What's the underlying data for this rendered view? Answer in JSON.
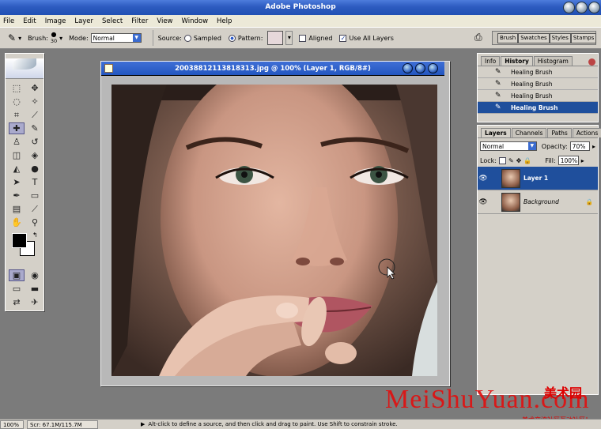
{
  "app": {
    "title": "Adobe Photoshop"
  },
  "menu": [
    "File",
    "Edit",
    "Image",
    "Layer",
    "Select",
    "Filter",
    "View",
    "Window",
    "Help"
  ],
  "options": {
    "brush_label": "Brush:",
    "brush_size": "30",
    "mode_label": "Mode:",
    "mode_value": "Normal",
    "source_label": "Source:",
    "sampled": "Sampled",
    "pattern": "Pattern:",
    "aligned": "Aligned",
    "use_all_layers": "Use All Layers"
  },
  "palette_well": [
    "Brush",
    "Swatches",
    "Styles",
    "Stamps"
  ],
  "document": {
    "title": "20038812113818313.jpg @ 100% (Layer 1, RGB/8#)"
  },
  "history": {
    "tabs": [
      "Info",
      "History",
      "Histogram"
    ],
    "items": [
      "Healing Brush",
      "Healing Brush",
      "Healing Brush",
      "Healing Brush"
    ]
  },
  "layers": {
    "tabs": [
      "Layers",
      "Channels",
      "Paths",
      "Actions"
    ],
    "blend": "Normal",
    "opacity_label": "Opacity:",
    "opacity": "70%",
    "lock_label": "Lock:",
    "fill_label": "Fill:",
    "fill": "100%",
    "rows": [
      "Layer 1",
      "Background"
    ]
  },
  "status": {
    "zoom": "100%",
    "scratch": "Scr: 67.1M/115.7M",
    "hint": "Alt-click to define a source, and then click and drag to paint. Use Shift to constrain stroke."
  },
  "watermark": {
    "text": "MeiShuYuan.com",
    "cn": "美术园",
    "cn2": "美术交流社区互动社区！"
  }
}
